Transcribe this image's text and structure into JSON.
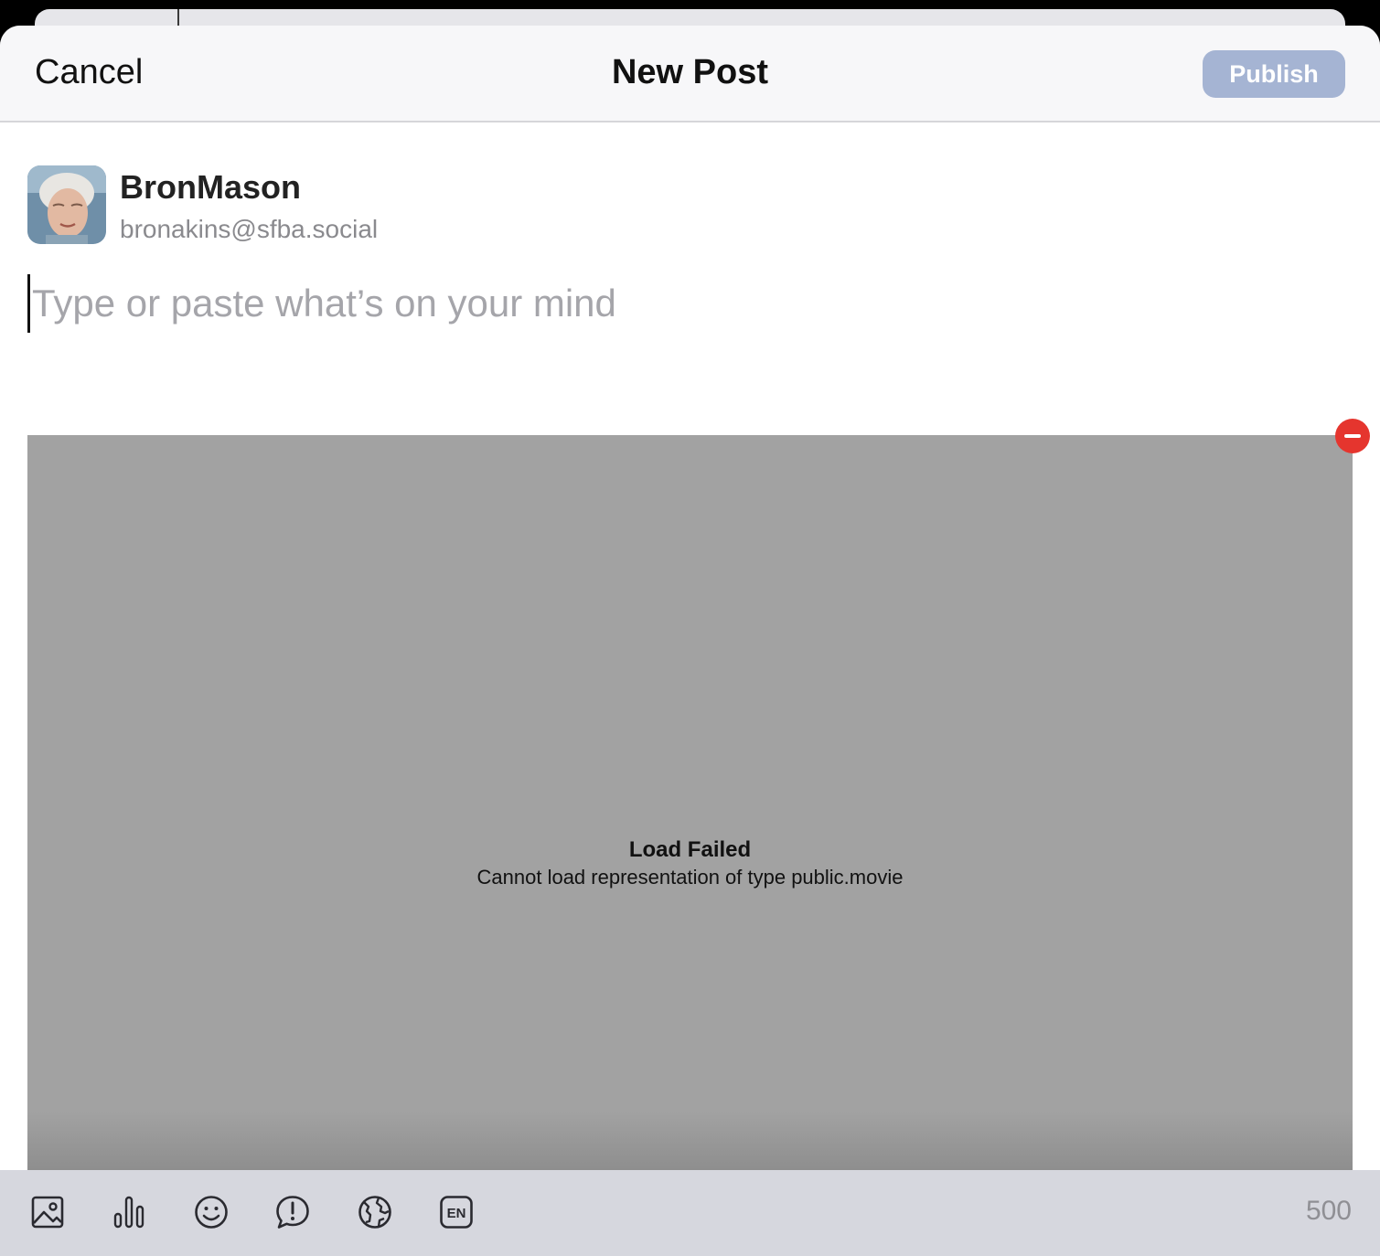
{
  "navbar": {
    "cancel_label": "Cancel",
    "title": "New Post",
    "publish_label": "Publish"
  },
  "account": {
    "display_name": "BronMason",
    "handle": "bronakins@sfba.social"
  },
  "composer": {
    "placeholder": "Type or paste what’s on your mind",
    "value": ""
  },
  "attachment": {
    "error_title": "Load Failed",
    "error_message": "Cannot load representation of type public.movie"
  },
  "toolbar": {
    "icons": [
      "photo-icon",
      "poll-icon",
      "emoji-icon",
      "content-warning-icon",
      "visibility-globe-icon",
      "language-icon"
    ],
    "language_code": "EN",
    "char_remaining": "500"
  },
  "colors": {
    "publish_disabled": "#a5b4d3",
    "remove_red": "#e5352e",
    "toolbar_bg": "#d6d7de"
  }
}
